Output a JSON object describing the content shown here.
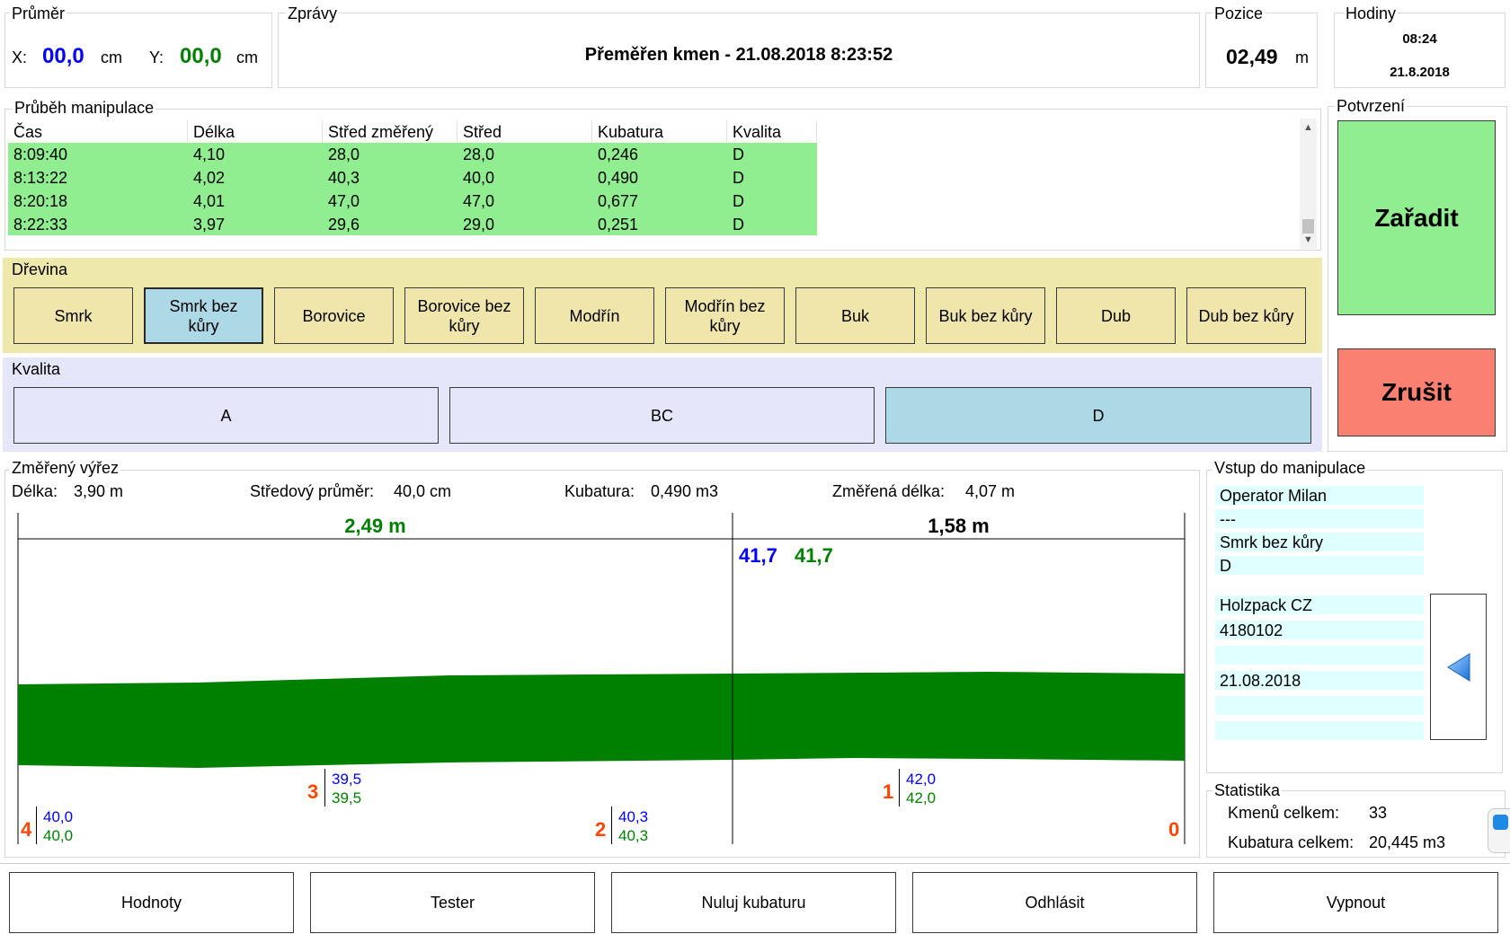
{
  "prumer": {
    "title": "Průměr",
    "x_label": "X:",
    "x_value": "00,0",
    "x_unit": "cm",
    "y_label": "Y:",
    "y_value": "00,0",
    "y_unit": "cm"
  },
  "zpravy": {
    "title": "Zprávy",
    "message": "Přeměřen kmen - 21.08.2018 8:23:52"
  },
  "pozice": {
    "title": "Pozice",
    "value": "02,49",
    "unit": "m"
  },
  "hodiny": {
    "title": "Hodiny",
    "time": "08:24",
    "date": "21.8.2018"
  },
  "prubeh": {
    "title": "Průběh manipulace",
    "columns": [
      "Čas",
      "Délka",
      "Střed změřený",
      "Střed",
      "Kubatura",
      "Kvalita"
    ],
    "rows": [
      [
        "8:09:40",
        "4,10",
        "28,0",
        "28,0",
        "0,246",
        "D"
      ],
      [
        "8:13:22",
        "4,02",
        "40,3",
        "40,0",
        "0,490",
        "D"
      ],
      [
        "8:20:18",
        "4,01",
        "47,0",
        "47,0",
        "0,677",
        "D"
      ],
      [
        "8:22:33",
        "3,97",
        "29,6",
        "29,0",
        "0,251",
        "D"
      ]
    ]
  },
  "potvrzeni": {
    "title": "Potvrzení",
    "confirm": "Zařadit",
    "cancel": "Zrušit"
  },
  "drevina": {
    "title": "Dřevina",
    "items": [
      "Smrk",
      "Smrk bez kůry",
      "Borovice",
      "Borovice bez kůry",
      "Modřín",
      "Modřín bez kůry",
      "Buk",
      "Buk bez kůry",
      "Dub",
      "Dub bez kůry"
    ],
    "selected": "Smrk bez kůry"
  },
  "kvalita": {
    "title": "Kvalita",
    "items": [
      "A",
      "BC",
      "D"
    ],
    "selected": "D"
  },
  "vyrez": {
    "title": "Změřený výřez",
    "delka_label": "Délka:",
    "delka_value": "3,90 m",
    "stred_label": "Středový průměr:",
    "stred_value": "40,0 cm",
    "kub_label": "Kubatura:",
    "kub_value": "0,490 m3",
    "zmer_label": "Změřená délka:",
    "zmer_value": "4,07 m",
    "left_length": "2,49 m",
    "right_length": "1,58 m",
    "top_blue": "41,7",
    "top_green": "41,7",
    "markers": [
      {
        "num": "4",
        "blue": "40,0",
        "green": "40,0"
      },
      {
        "num": "3",
        "blue": "39,5",
        "green": "39,5"
      },
      {
        "num": "2",
        "blue": "40,3",
        "green": "40,3"
      },
      {
        "num": "1",
        "blue": "42,0",
        "green": "42,0"
      },
      {
        "num": "0"
      }
    ]
  },
  "vstup": {
    "title": "Vstup do manipulace",
    "fields": [
      "Operator Milan",
      "---",
      "Smrk bez kůry",
      "D"
    ],
    "fields2": [
      "Holzpack CZ",
      "4180102",
      "",
      "21.08.2018",
      "",
      ""
    ]
  },
  "statistika": {
    "title": "Statistika",
    "kmenu_label": "Kmenů celkem:",
    "kmenu_value": "33",
    "kub_label": "Kubatura celkem:",
    "kub_value": "20,445 m3"
  },
  "bottom_buttons": [
    "Hodnoty",
    "Tester",
    "Nuluj kubaturu",
    "Odhlásit",
    "Vypnout"
  ],
  "colors": {
    "green_row": "#90ee90",
    "species_bg": "#f0e6ab",
    "selected": "#add8e6",
    "quality_bg": "#e6e6fa",
    "confirm": "#90ee90",
    "cancel": "#fa8072",
    "log_fill": "#008000"
  }
}
